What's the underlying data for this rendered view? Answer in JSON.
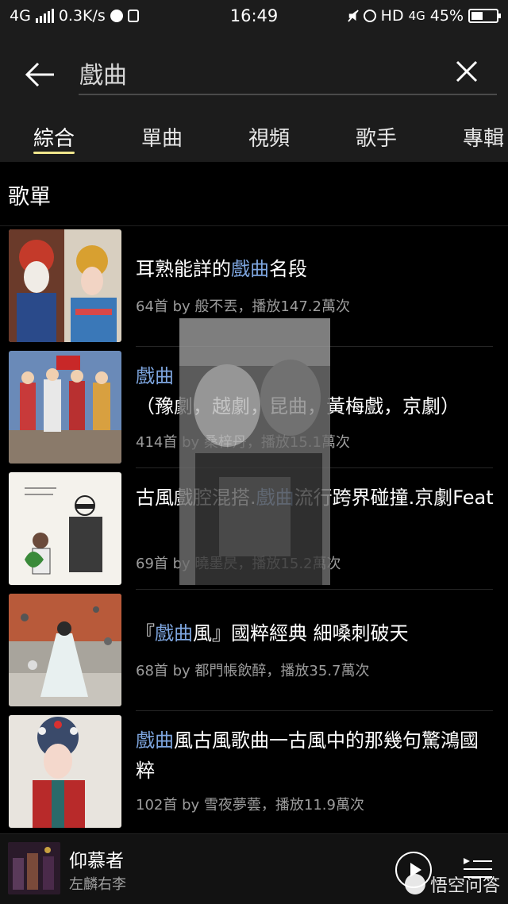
{
  "status_bar": {
    "network": "4G",
    "speed": "0.3K/s",
    "time": "16:49",
    "hd": "HD",
    "network2": "4G",
    "battery": "45%",
    "battery_level": 0.45
  },
  "search": {
    "query": "戲曲"
  },
  "tabs": [
    "綜合",
    "單曲",
    "視頻",
    "歌手",
    "專輯"
  ],
  "active_tab": 0,
  "section": {
    "title": "歌單"
  },
  "playlists": [
    {
      "title_hl": "",
      "title_rest": "耳熟能詳的",
      "title_hl2": "戲曲",
      "title_tail": "名段",
      "meta": "64首  by 般不丟，播放147.2萬次"
    },
    {
      "title_hl": "戲曲",
      "title_rest": "（豫劇，越劇，昆曲，黃梅戲，京劇）",
      "meta": "414首  by 桑梓丹，播放15.1萬次"
    },
    {
      "title_hl": "",
      "title_rest": "古風戲腔混搭.",
      "title_hl2": "戲曲",
      "title_tail": "流行跨界碰撞.京劇Feat",
      "meta": "69首  by 曉墨昃，播放15.2萬次"
    },
    {
      "title_pre": "『",
      "title_hl": "戲曲",
      "title_rest": "風』國粹經典 細嗓刺破天",
      "meta": "68首  by 都門帳飲醉，播放35.7萬次"
    },
    {
      "title_hl": "戲曲",
      "title_rest": "風古風歌曲一古風中的那幾句驚鴻國粹",
      "meta": "102首  by 雪夜夢蕓，播放11.9萬次"
    }
  ],
  "player": {
    "song": "仰慕者",
    "artist": "左麟右李"
  },
  "watermark": {
    "text": "悟空问答"
  },
  "colors": {
    "highlight": "#7ea6e0",
    "tab_underline": "#f0e68c",
    "background": "#000000",
    "header": "#1c1c1c"
  },
  "icons": [
    "signal-icon",
    "data-icon",
    "database-icon",
    "mute-icon",
    "alarm-icon",
    "battery-icon",
    "back-arrow-icon",
    "clear-icon",
    "play-icon",
    "playlist-icon",
    "wukong-logo-icon"
  ]
}
